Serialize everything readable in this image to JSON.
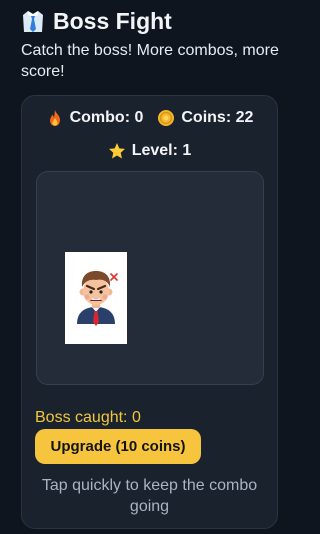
{
  "header": {
    "title_icon": "necktie-icon",
    "title": "Boss Fight",
    "subtitle": "Catch the boss! More combos, more score!"
  },
  "stats": {
    "combo_icon": "fire-icon",
    "combo_label": "Combo: 0",
    "coins_icon": "coin-icon",
    "coins_label": "Coins: 22",
    "level_icon": "star-icon",
    "level_label": "Level: 1"
  },
  "arena": {
    "target_icon": "angry-boss-icon"
  },
  "footer": {
    "boss_caught_label": "Boss caught: 0",
    "upgrade_label": "Upgrade (10 coins)",
    "hint": "Tap quickly to keep the combo going"
  },
  "colors": {
    "background": "#0f151e",
    "card": "#1a222d",
    "arena": "#232c38",
    "accent": "#f7c53d",
    "caught_text": "#f3c73d",
    "hint_text": "#a9b3c1"
  }
}
